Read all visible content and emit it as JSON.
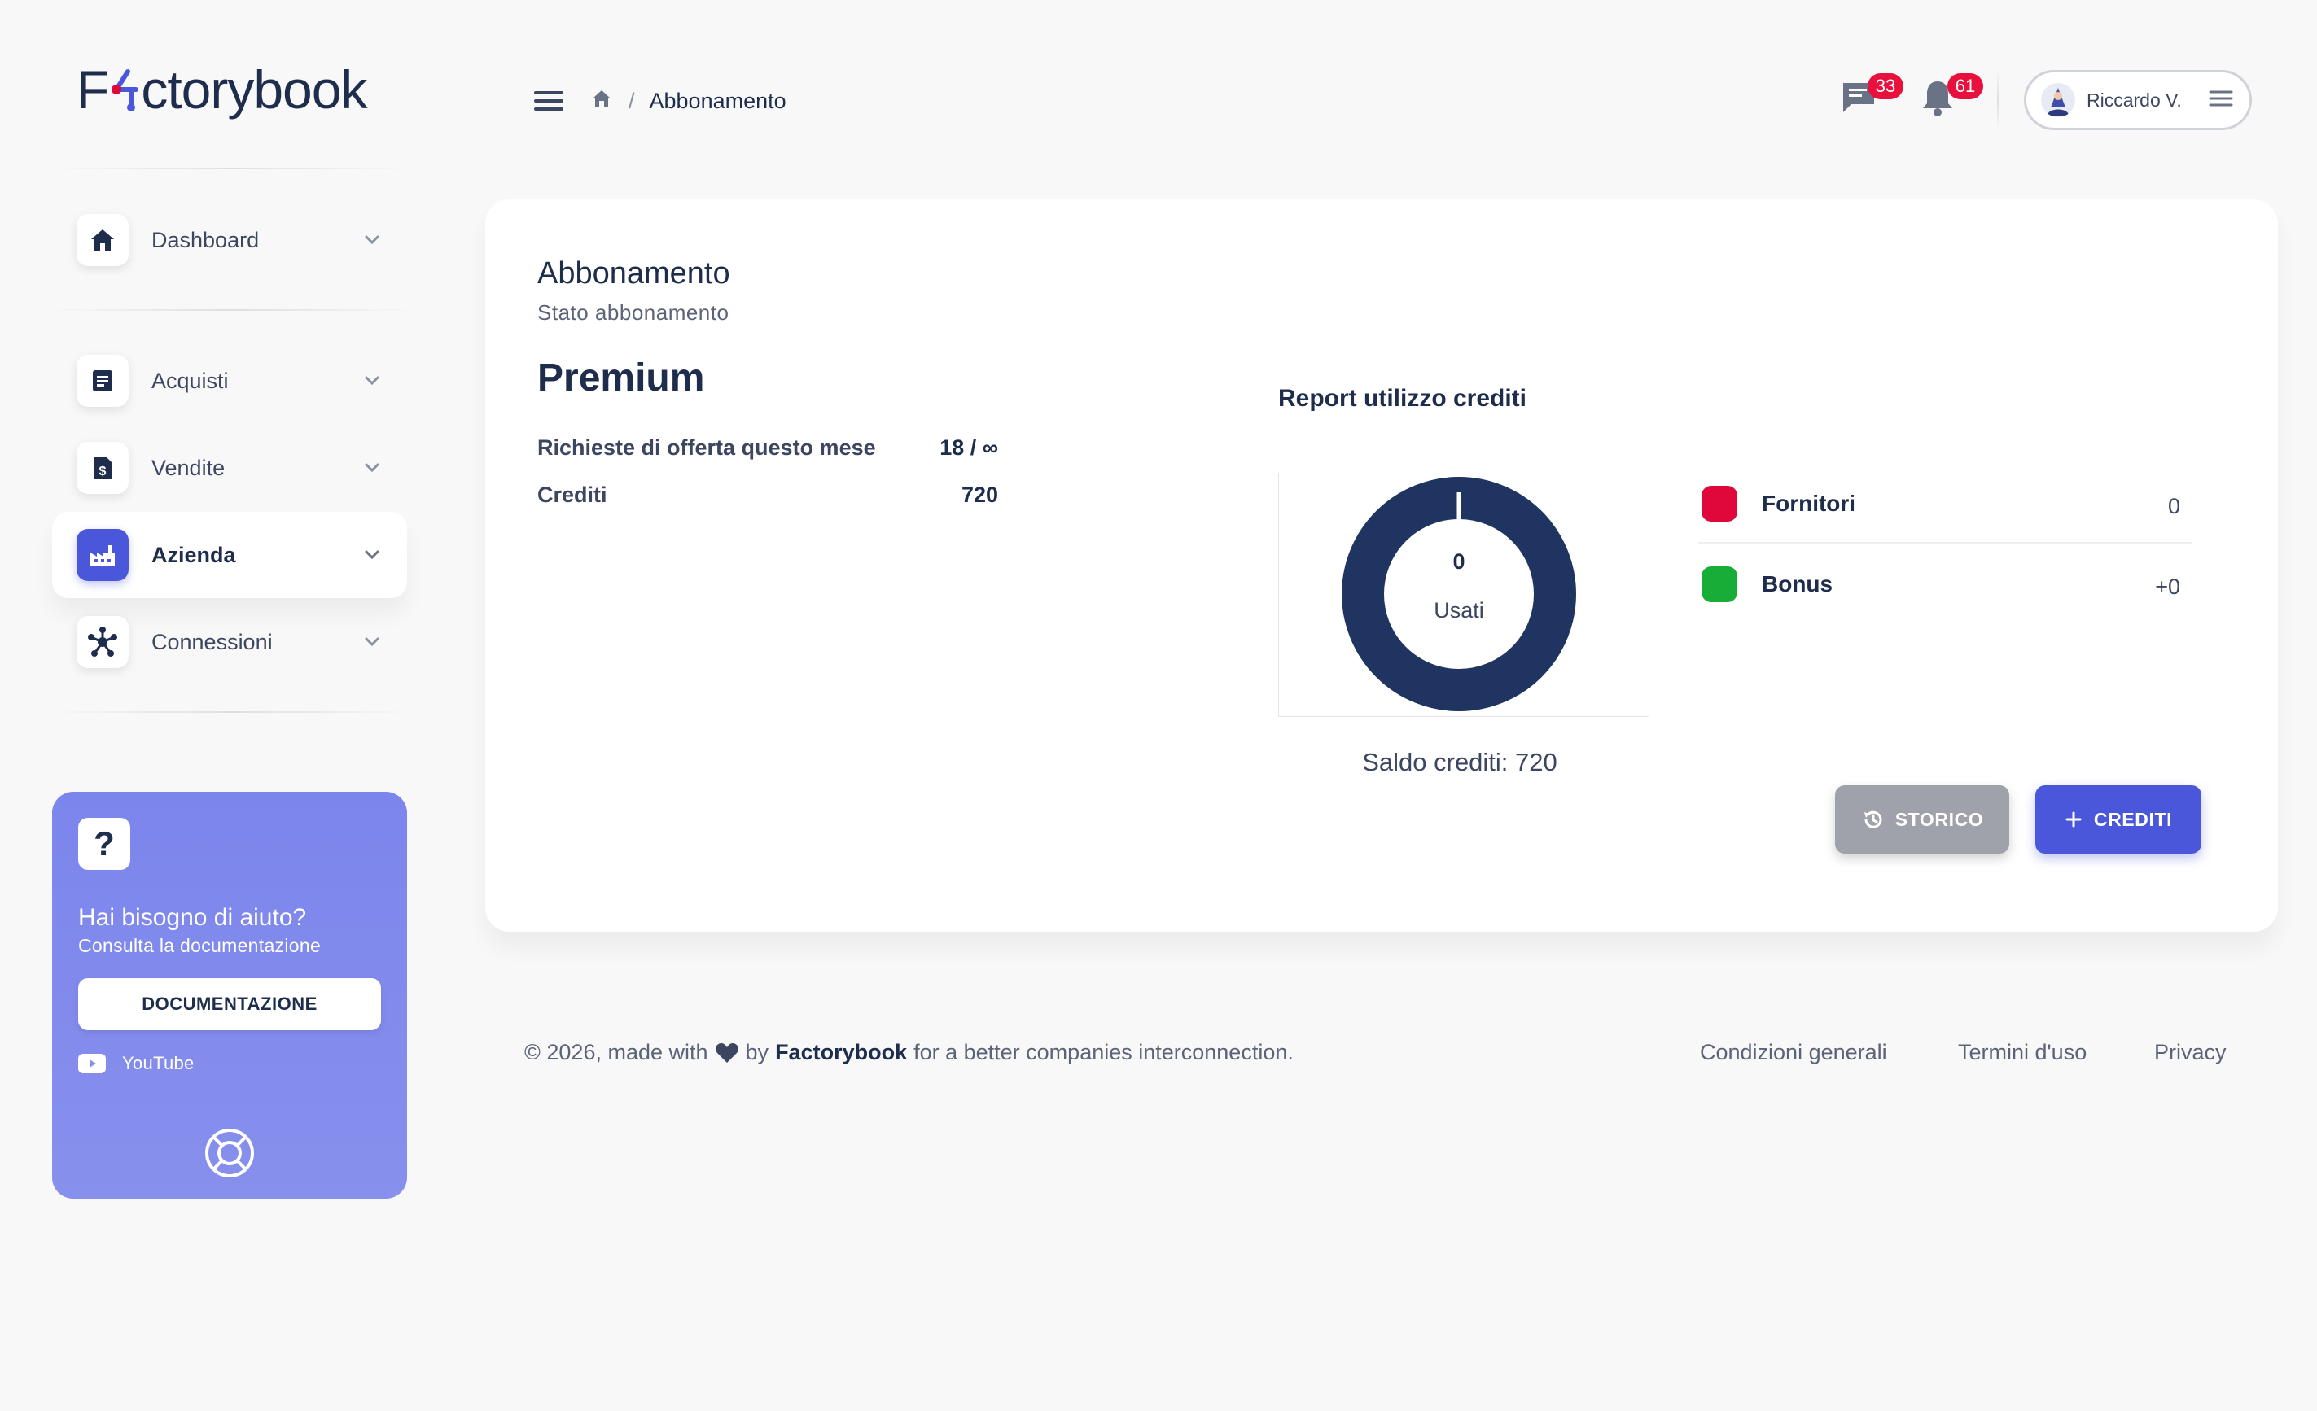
{
  "brand": {
    "logo_before": "F",
    "logo_after": "ctorybook"
  },
  "sidebar": {
    "items": [
      {
        "label": "Dashboard",
        "icon": "home-icon"
      },
      {
        "label": "Acquisti",
        "icon": "document-icon"
      },
      {
        "label": "Vendite",
        "icon": "invoice-icon"
      },
      {
        "label": "Azienda",
        "icon": "factory-icon",
        "active": true
      },
      {
        "label": "Connessioni",
        "icon": "network-icon"
      }
    ],
    "help": {
      "icon_text": "?",
      "title": "Hai bisogno di aiuto?",
      "subtitle": "Consulta la documentazione",
      "button": "DOCUMENTAZIONE",
      "youtube": "YouTube"
    }
  },
  "header": {
    "breadcrumb": "Abbonamento",
    "messages_count": "33",
    "notifications_count": "61",
    "user_name": "Riccardo V."
  },
  "card": {
    "title": "Abbonamento",
    "subtitle": "Stato abbonamento",
    "plan": "Premium",
    "rows": [
      {
        "label": "Richieste di offerta questo mese",
        "value": "18 / ∞"
      },
      {
        "label": "Crediti",
        "value": "720"
      }
    ],
    "report": {
      "title": "Report utilizzo crediti",
      "center_value": "0",
      "center_label": "Usati",
      "saldo": "Saldo crediti: 720",
      "legend": [
        {
          "name": "Fornitori",
          "value": "0",
          "color": "#e0073b"
        },
        {
          "name": "Bonus",
          "value": "+0",
          "color": "#17ad37"
        }
      ]
    },
    "buttons": {
      "storico": "STORICO",
      "crediti": "CREDITI"
    }
  },
  "footer": {
    "prefix": "© 2026, made with",
    "by": "by",
    "brand": "Factorybook",
    "suffix": "for a better companies interconnection.",
    "links": [
      "Condizioni generali",
      "Termini d'uso",
      "Privacy"
    ]
  },
  "colors": {
    "primary": "#4b57db",
    "navy": "#1f2d4d",
    "donut": "#1f3460",
    "badge": "#e8103c"
  }
}
